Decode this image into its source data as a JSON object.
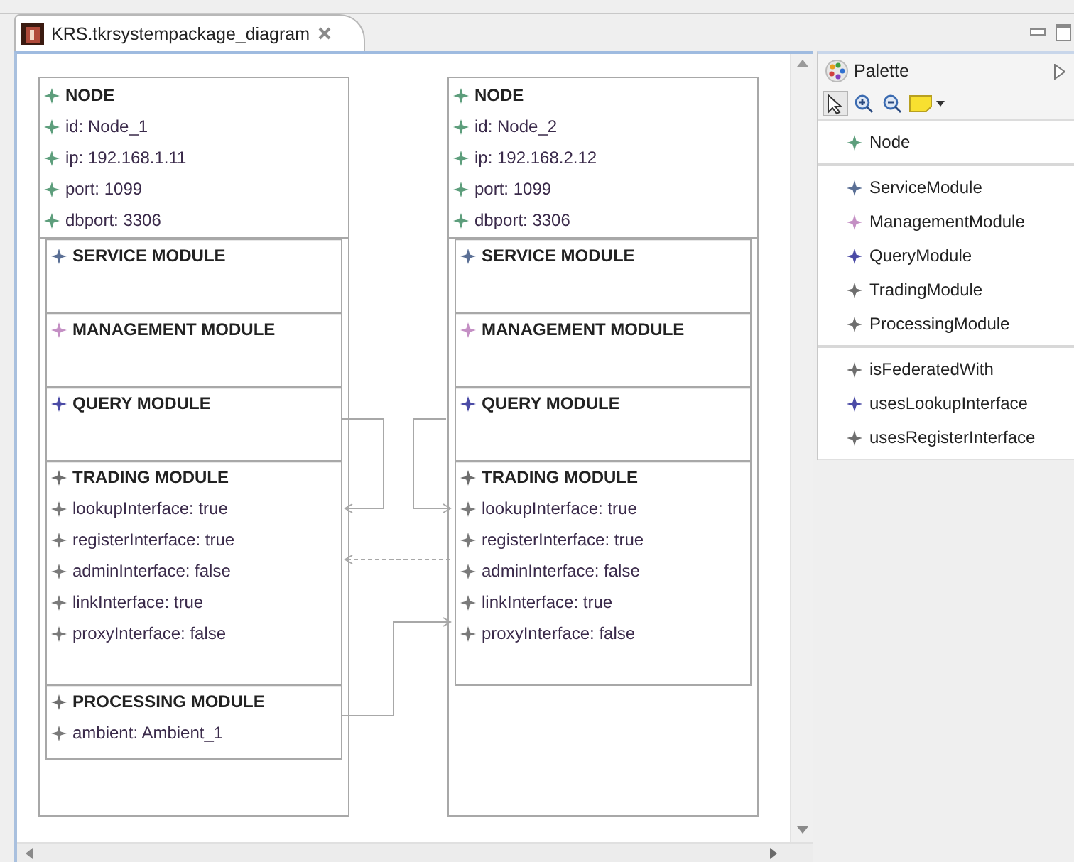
{
  "editor_tab": {
    "title": "KRS.tkrsystempackage_diagram",
    "selected": true
  },
  "nodes": [
    {
      "heading": "NODE",
      "color": "#5d9e7c",
      "properties": [
        "id: Node_1",
        "ip: 192.168.1.11",
        "port: 1099",
        "dbport: 3306"
      ],
      "modules": [
        {
          "heading": "SERVICE MODULE",
          "color": "#5a6f95"
        },
        {
          "heading": "MANAGEMENT MODULE",
          "color": "#c48fc4"
        },
        {
          "heading": "QUERY MODULE",
          "color": "#4b4ba6"
        },
        {
          "heading": "TRADING MODULE",
          "color": "#6e6e6e",
          "properties": [
            "lookupInterface: true",
            "registerInterface: true",
            "adminInterface: false",
            "linkInterface: true",
            "proxyInterface: false"
          ]
        },
        {
          "heading": "PROCESSING MODULE",
          "color": "#6e6e6e",
          "properties": [
            "ambient: Ambient_1"
          ]
        }
      ]
    },
    {
      "heading": "NODE",
      "color": "#5d9e7c",
      "properties": [
        "id: Node_2",
        "ip: 192.168.2.12",
        "port: 1099",
        "dbport: 3306"
      ],
      "modules": [
        {
          "heading": "SERVICE MODULE",
          "color": "#5a6f95"
        },
        {
          "heading": "MANAGEMENT MODULE",
          "color": "#c48fc4"
        },
        {
          "heading": "QUERY MODULE",
          "color": "#4b4ba6"
        },
        {
          "heading": "TRADING MODULE",
          "color": "#6e6e6e",
          "properties": [
            "lookupInterface: true",
            "registerInterface: true",
            "adminInterface: false",
            "linkInterface: true",
            "proxyInterface: false"
          ]
        }
      ]
    }
  ],
  "connections": [
    {
      "kind": "solid"
    },
    {
      "kind": "solid"
    },
    {
      "kind": "dashed"
    },
    {
      "kind": "solid"
    }
  ],
  "palette": {
    "title": "Palette",
    "groups": [
      [
        {
          "label": "Node",
          "color": "#5d9e7c"
        }
      ],
      [
        {
          "label": "ServiceModule",
          "color": "#5a6f95"
        },
        {
          "label": "ManagementModule",
          "color": "#c48fc4"
        },
        {
          "label": "QueryModule",
          "color": "#4b4ba6"
        },
        {
          "label": "TradingModule",
          "color": "#6e6e6e"
        },
        {
          "label": "ProcessingModule",
          "color": "#6e6e6e"
        }
      ],
      [
        {
          "label": "isFederatedWith",
          "color": "#6e6e6e"
        },
        {
          "label": "usesLookupInterface",
          "color": "#4b4ba6"
        },
        {
          "label": "usesRegisterInterface",
          "color": "#6e6e6e"
        }
      ]
    ]
  }
}
